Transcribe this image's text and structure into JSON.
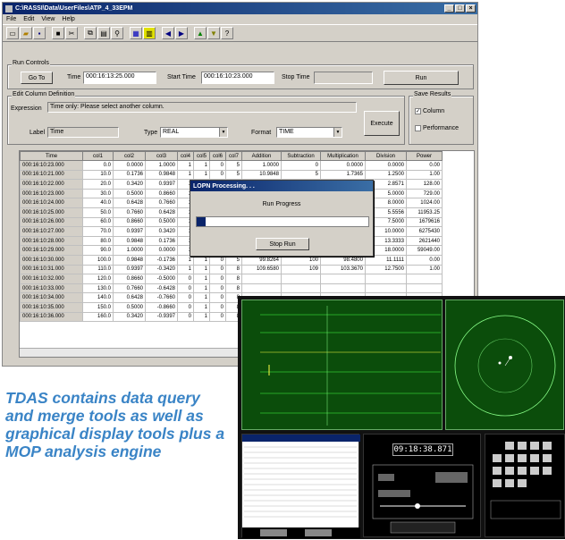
{
  "window": {
    "title": "C:\\RASSI\\Data\\UserFiles\\ATP_4_33EPM",
    "buttons": [
      "_",
      "□",
      "×"
    ]
  },
  "menu": [
    "File",
    "Edit",
    "View",
    "Help"
  ],
  "toolbar_icons": [
    "new-icon",
    "open-icon",
    "save-icon",
    "print-icon",
    "cut-icon",
    "copy-icon",
    "paste-icon",
    "find-icon",
    "chart-icon",
    "table-icon",
    "prev-icon",
    "next-icon",
    "filter-icon",
    "sort-icon",
    "help-icon"
  ],
  "run_controls": {
    "group_label": "Run Controls",
    "goto_label": "Go To",
    "time_label": "Time",
    "time_value": "000:16:13:25.000",
    "start_time_label": "Start Time",
    "start_time_value": "000:16:10:23.000",
    "stop_time_label": "Stop Time",
    "stop_time_value": "",
    "run_label": "Run"
  },
  "edit_column": {
    "group_label": "Edit Column Definition",
    "expression_label": "Expression",
    "expression_value": "Time only: Please select another column.",
    "label_label": "Label",
    "label_value": "Time",
    "type_label": "Type",
    "type_value": "REAL",
    "format_label": "Format",
    "format_value": "TIME",
    "execute_label": "Execute"
  },
  "save_results": {
    "group_label": "Save Results",
    "column_label": "Column",
    "column_checked": true,
    "performance_label": "Performance",
    "performance_checked": false
  },
  "table": {
    "columns": [
      "Time",
      "col1",
      "col2",
      "col3",
      "col4",
      "col5",
      "col6",
      "col7",
      "Addition",
      "Subtraction",
      "Multiplication",
      "Division",
      "Power"
    ],
    "rows": [
      [
        "000:16:10:23.000",
        "0.0",
        "0.0000",
        "1.0000",
        "1",
        "1",
        "0",
        "5",
        "1.0000",
        "0",
        "0.0000",
        "0.0000",
        "0.00"
      ],
      [
        "000:16:10:21.000",
        "10.0",
        "0.1736",
        "0.9848",
        "1",
        "1",
        "0",
        "5",
        "10.9848",
        "5",
        "1.7365",
        "1.2500",
        "1.00"
      ],
      [
        "000:16:10:22.000",
        "20.0",
        "0.3420",
        "0.9397",
        "1",
        "0",
        "0",
        "5",
        "",
        "",
        "6.8400",
        "2.8571",
        "128.00"
      ],
      [
        "000:16:10:23.000",
        "30.0",
        "0.5000",
        "0.8660",
        "1",
        "0",
        "0",
        "5",
        "",
        "",
        "15.0000",
        "5.0000",
        "729.00"
      ],
      [
        "000:16:10:24.000",
        "40.0",
        "0.6428",
        "0.7660",
        "1",
        "0",
        "0",
        "5",
        "",
        "",
        "25.7120",
        "8.0000",
        "1024.00"
      ],
      [
        "000:16:10:25.000",
        "50.0",
        "0.7660",
        "0.6428",
        "1",
        "0",
        "0",
        "5",
        "",
        "",
        "38.3000",
        "5.5556",
        "11953.25"
      ],
      [
        "000:16:10:26.000",
        "60.0",
        "0.8660",
        "0.5000",
        "1",
        "0",
        "0",
        "5",
        "",
        "",
        "51.9600",
        "7.5000",
        "1679616"
      ],
      [
        "000:16:10:27.000",
        "70.0",
        "0.9397",
        "0.3420",
        "1",
        "0",
        "0",
        "5",
        "",
        "",
        "65.7790",
        "10.0000",
        "6275430"
      ],
      [
        "000:16:10:28.000",
        "80.0",
        "0.9848",
        "0.1736",
        "1",
        "0",
        "0",
        "5",
        "",
        "",
        "78.7840",
        "13.3333",
        "2621440"
      ],
      [
        "000:16:10:29.000",
        "90.0",
        "1.0000",
        "0.0000",
        "1",
        "0",
        "0",
        "5",
        "90.0000",
        "81",
        "90.0000",
        "18.0000",
        "59049.00"
      ],
      [
        "000:16:10:30.000",
        "100.0",
        "0.9848",
        "-0.1736",
        "1",
        "1",
        "0",
        "5",
        "99.8264",
        "100",
        "98.4800",
        "11.1111",
        "0.00"
      ],
      [
        "000:16:10:31.000",
        "110.0",
        "0.9397",
        "-0.3420",
        "1",
        "1",
        "0",
        "8",
        "109.6580",
        "109",
        "103.3670",
        "12.7500",
        "1.00"
      ],
      [
        "000:16:10:32.000",
        "120.0",
        "0.8660",
        "-0.5000",
        "0",
        "1",
        "0",
        "8",
        "",
        "",
        "",
        "",
        ""
      ],
      [
        "000:16:10:33.000",
        "130.0",
        "0.7660",
        "-0.6428",
        "0",
        "1",
        "0",
        "8",
        "",
        "",
        "",
        "",
        ""
      ],
      [
        "000:16:10:34.000",
        "140.0",
        "0.6428",
        "-0.7660",
        "0",
        "1",
        "0",
        "8",
        "",
        "",
        "",
        "",
        ""
      ],
      [
        "000:16:10:35.000",
        "150.0",
        "0.5000",
        "-0.8660",
        "0",
        "1",
        "0",
        "8",
        "",
        "",
        "",
        "",
        ""
      ],
      [
        "000:16:10:36.000",
        "160.0",
        "0.3420",
        "-0.9397",
        "0",
        "1",
        "0",
        "8",
        "",
        "",
        "",
        "",
        ""
      ]
    ]
  },
  "dialog": {
    "title": "LOPN Processing. . .",
    "progress_label": "Run Progress",
    "progress": 0.05,
    "stop_label": "Stop Run"
  },
  "caption": "TDAS contains data query and merge tools as well as graphical display tools plus a MOP analysis engine",
  "inset": {
    "green_color": "#0b4d0b",
    "dark_color": "#000000",
    "clock_value": "09:18:38.871"
  }
}
